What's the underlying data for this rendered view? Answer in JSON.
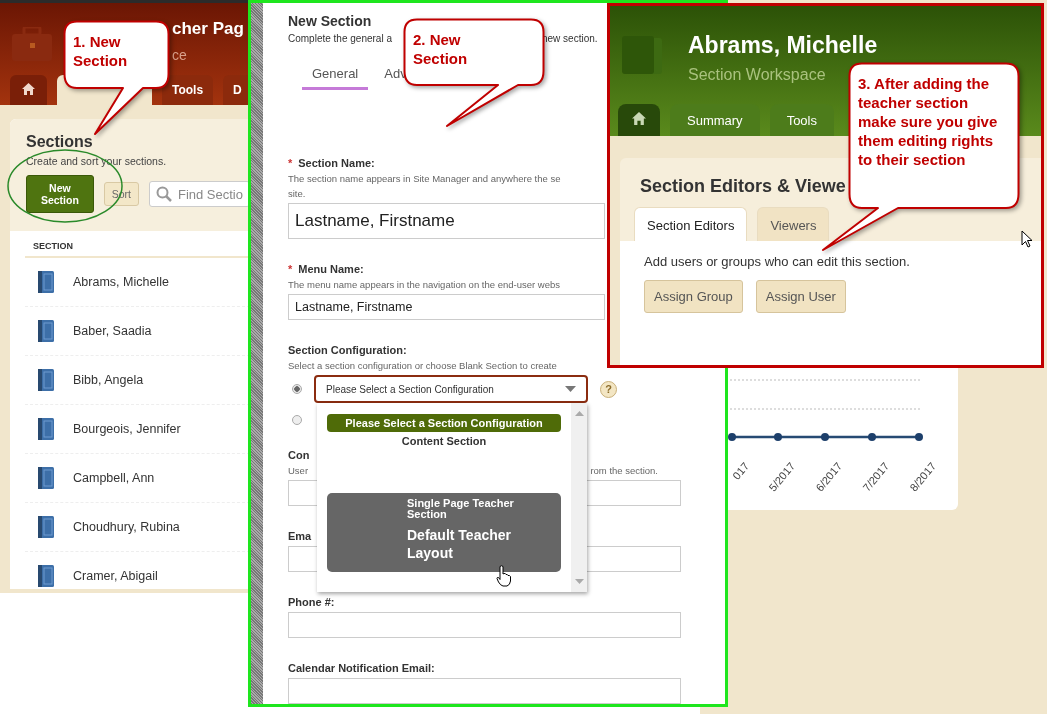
{
  "section_list_window": {
    "title": "cher Pag",
    "subtitle": "ce",
    "tabs": [
      {
        "kind": "home",
        "selected": false
      },
      {
        "kind": "covered",
        "selected": true
      },
      {
        "kind": "text",
        "label": "Tools",
        "selected": false
      },
      {
        "kind": "text",
        "label": "D",
        "selected": false
      }
    ],
    "heading": "Sections",
    "description": "Create and sort your sections.",
    "new_button": "New Section",
    "sort_button": "Sort",
    "search_placeholder": "Find Sectio",
    "column": "SECTION",
    "rows": [
      "Abrams, Michelle",
      "Baber, Saadia",
      "Bibb, Angela",
      "Bourgeois, Jennifer",
      "Campbell, Ann",
      "Choudhury, Rubina",
      "Cramer, Abigail"
    ]
  },
  "new_section_form": {
    "title": "New Section",
    "description_parts": [
      "Complete the general a",
      "new section."
    ],
    "tabs": [
      {
        "label": "General",
        "selected": true
      },
      {
        "label": "Adv",
        "selected": false
      }
    ],
    "fields": [
      {
        "kind": "large_text",
        "label": "Section Name:",
        "marker": "*",
        "description": [
          "The section name appears in Site Manager and anywhere the se",
          "site."
        ],
        "value": "Lastname, Firstname"
      },
      {
        "kind": "text",
        "label": "Menu Name:",
        "marker": "*",
        "description": [
          "The menu name appears in the navigation on the end-user webs"
        ],
        "value": "Lastname, Firstname"
      },
      {
        "kind": "config",
        "label": "Section Configuration:",
        "description": [
          "Select a section configuration or choose Blank Section to create"
        ],
        "radios": [
          {
            "selected": true
          },
          {
            "selected": false
          }
        ],
        "select_value": "Please Select a Section Configuration",
        "help_symbol": "?"
      },
      {
        "kind": "split",
        "label": "Con",
        "description": [
          "User",
          "rom the section."
        ]
      },
      {
        "kind": "text",
        "label": "Ema"
      },
      {
        "kind": "text",
        "label": "Phone #:"
      },
      {
        "kind": "text",
        "label": "Calendar Notification Email:"
      }
    ],
    "dropdown": [
      {
        "kind": "option",
        "label": "Please Select a Section Configuration",
        "selected": true
      },
      {
        "kind": "option",
        "label": "Content Section",
        "selected": false
      },
      {
        "kind": "group",
        "label": "Single Page Teacher Section",
        "highlighted": true,
        "children": [
          {
            "kind": "option",
            "label": "Default Teacher Layout",
            "selected": false
          }
        ]
      }
    ]
  },
  "chart_card": {
    "x_labels": [
      "017",
      "5/2017",
      "6/2017",
      "7/2017",
      "8/2017"
    ]
  },
  "section_workspace_window": {
    "title": "Abrams, Michelle",
    "subtitle": "Section Workspace",
    "tabs": [
      {
        "kind": "home",
        "selected": false
      },
      {
        "kind": "text",
        "label": "Summary",
        "selected": false
      },
      {
        "kind": "text",
        "label": "Tools",
        "selected": false
      }
    ],
    "heading": "Section Editors & Viewe",
    "panel_tabs": [
      {
        "label": "Section Editors",
        "selected": true
      },
      {
        "label": "Viewers",
        "selected": false
      }
    ],
    "description": "Add users or groups who can edit this section.",
    "buttons": [
      "Assign Group",
      "Assign User"
    ]
  },
  "callouts": [
    {
      "text": "1. New Section"
    },
    {
      "text": "2.  New Section"
    },
    {
      "text": "3. After adding the teacher section make sure you give them editing rights to their section"
    }
  ]
}
